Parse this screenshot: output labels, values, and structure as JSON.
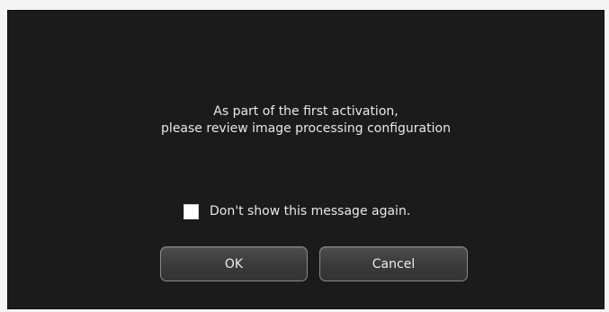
{
  "dialog": {
    "message_line1": "As part of the first activation,",
    "message_line2": "please review image processing configuration",
    "checkbox": {
      "label": "Don't show this message again.",
      "checked": false
    },
    "buttons": {
      "ok_label": "OK",
      "cancel_label": "Cancel"
    },
    "colors": {
      "background": "#1b1b1b",
      "text": "#e8e8e8",
      "button_border": "#8a8a8a"
    }
  }
}
